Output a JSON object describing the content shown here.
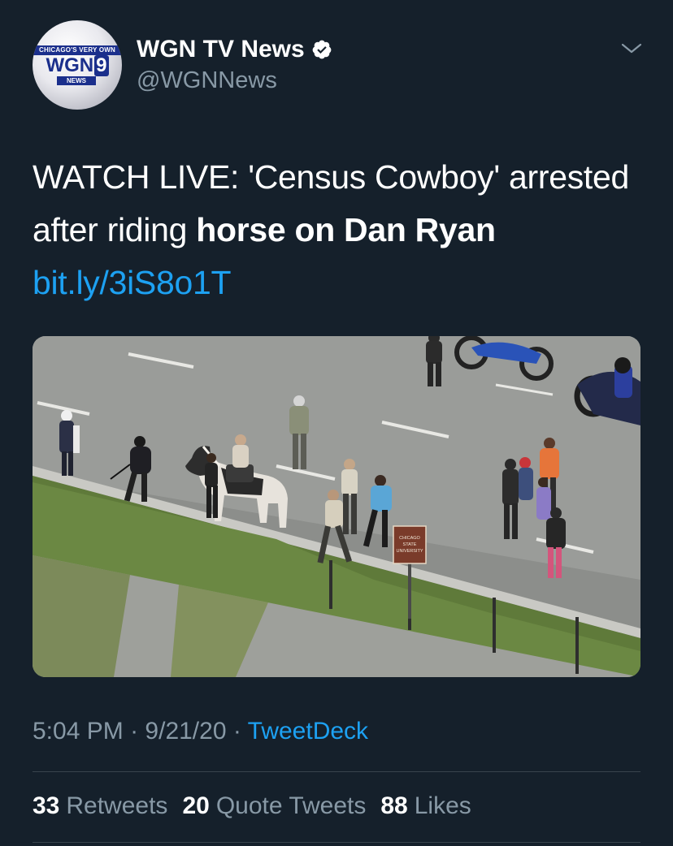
{
  "author": {
    "display_name": "WGN TV News",
    "handle": "@WGNNews",
    "verified": true,
    "avatar_band": "CHICAGO'S VERY OWN",
    "avatar_logo": "WGN",
    "avatar_logo_num": "9",
    "avatar_news": "NEWS"
  },
  "tweet": {
    "text_regular": "WATCH LIVE: 'Census Cowboy' arrested after riding ",
    "text_bold": "horse on Dan Ryan",
    "link": "bit.ly/3iS8o1T"
  },
  "media": {
    "alt": "Aerial view of a man leading a horse on an expressway with police and onlookers",
    "sign_text": "CHICAGO STATE UNIVERSITY"
  },
  "meta": {
    "time": "5:04 PM",
    "date": "9/21/20",
    "separator": "·",
    "source": "TweetDeck"
  },
  "stats": {
    "retweets_count": "33",
    "retweets_label": "Retweets",
    "quote_count": "20",
    "quote_label": "Quote Tweets",
    "likes_count": "88",
    "likes_label": "Likes"
  },
  "colors": {
    "background": "#15202b",
    "link": "#1da1f2",
    "secondary_text": "#8899a6",
    "divider": "#38444d"
  }
}
